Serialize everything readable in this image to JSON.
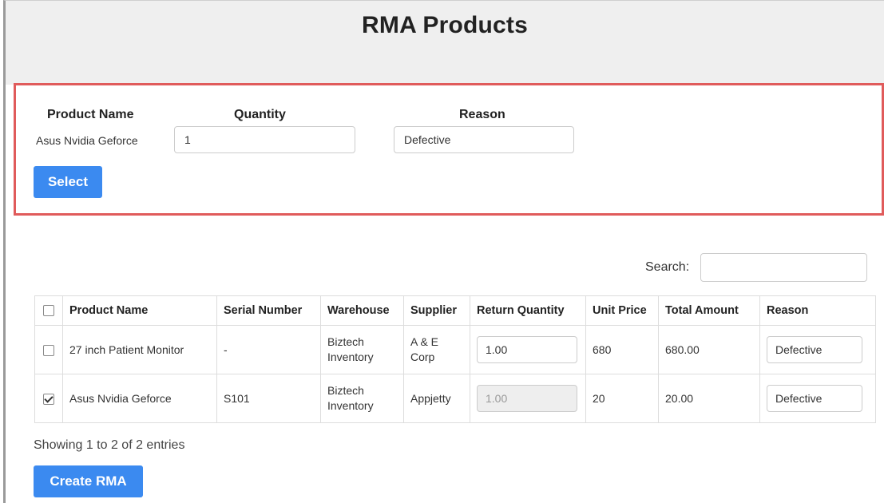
{
  "title": "RMA Products",
  "select_panel": {
    "headers": {
      "product_name": "Product Name",
      "quantity": "Quantity",
      "reason": "Reason"
    },
    "product_name_value": "Asus Nvidia Geforce",
    "quantity_value": "1",
    "reason_value": "Defective",
    "select_button": "Select",
    "border_color": "#e05b5b"
  },
  "table": {
    "search_label": "Search:",
    "search_value": "",
    "columns": [
      "Product Name",
      "Serial Number",
      "Warehouse",
      "Supplier",
      "Return Quantity",
      "Unit Price",
      "Total Amount",
      "Reason"
    ],
    "rows": [
      {
        "checked": false,
        "product_name": "27 inch Patient Monitor",
        "serial_number": "-",
        "warehouse_line1": "Biztech",
        "warehouse_line2": "Inventory",
        "supplier_line1": "A & E",
        "supplier_line2": "Corp",
        "return_quantity": "1.00",
        "return_quantity_disabled": false,
        "unit_price": "680",
        "total_amount": "680.00",
        "reason": "Defective"
      },
      {
        "checked": true,
        "product_name": "Asus Nvidia Geforce",
        "serial_number": "S101",
        "warehouse_line1": "Biztech",
        "warehouse_line2": "Inventory",
        "supplier_line1": "Appjetty",
        "supplier_line2": "",
        "return_quantity": "1.00",
        "return_quantity_disabled": true,
        "unit_price": "20",
        "total_amount": "20.00",
        "reason": "Defective"
      }
    ],
    "info": "Showing 1 to 2 of 2 entries"
  },
  "create_button": "Create RMA",
  "colors": {
    "primary_button": "#3b8af0",
    "header_background": "#efefef"
  }
}
